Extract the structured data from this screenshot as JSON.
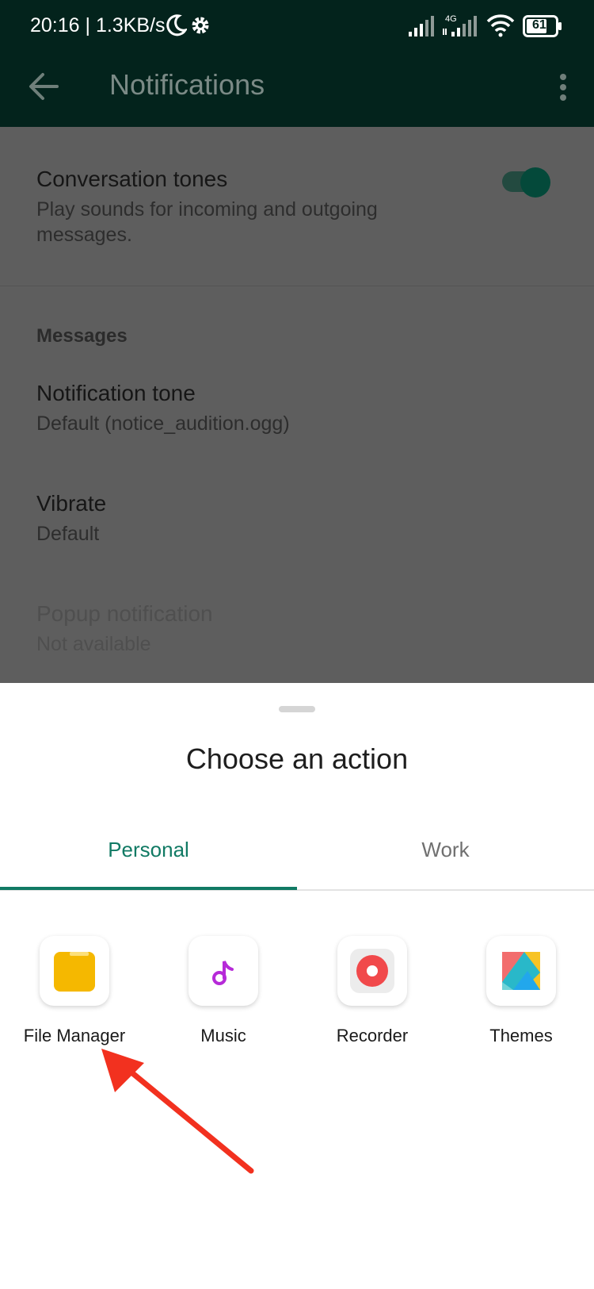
{
  "status_bar": {
    "time_speed": "20:16 | 1.3KB/s",
    "network_label": "4G",
    "battery": "61"
  },
  "app_bar": {
    "title": "Notifications"
  },
  "settings": {
    "conversation_tones": {
      "title": "Conversation tones",
      "subtitle": "Play sounds for incoming and outgoing messages.",
      "enabled": true
    },
    "messages_header": "Messages",
    "notification_tone": {
      "title": "Notification tone",
      "subtitle": "Default (notice_audition.ogg)"
    },
    "vibrate": {
      "title": "Vibrate",
      "subtitle": "Default"
    },
    "popup": {
      "title": "Popup notification",
      "subtitle": "Not available"
    }
  },
  "sheet": {
    "title": "Choose an action",
    "tabs": [
      {
        "label": "Personal",
        "selected": true
      },
      {
        "label": "Work",
        "selected": false
      }
    ],
    "apps": [
      {
        "label": "File Manager",
        "icon": "folder-icon"
      },
      {
        "label": "Music",
        "icon": "music-note-icon"
      },
      {
        "label": "Recorder",
        "icon": "record-icon"
      },
      {
        "label": "Themes",
        "icon": "themes-icon"
      }
    ]
  },
  "colors": {
    "app_bar": "#03231c",
    "accent": "#117a64",
    "annotation_arrow": "#f2311f"
  }
}
